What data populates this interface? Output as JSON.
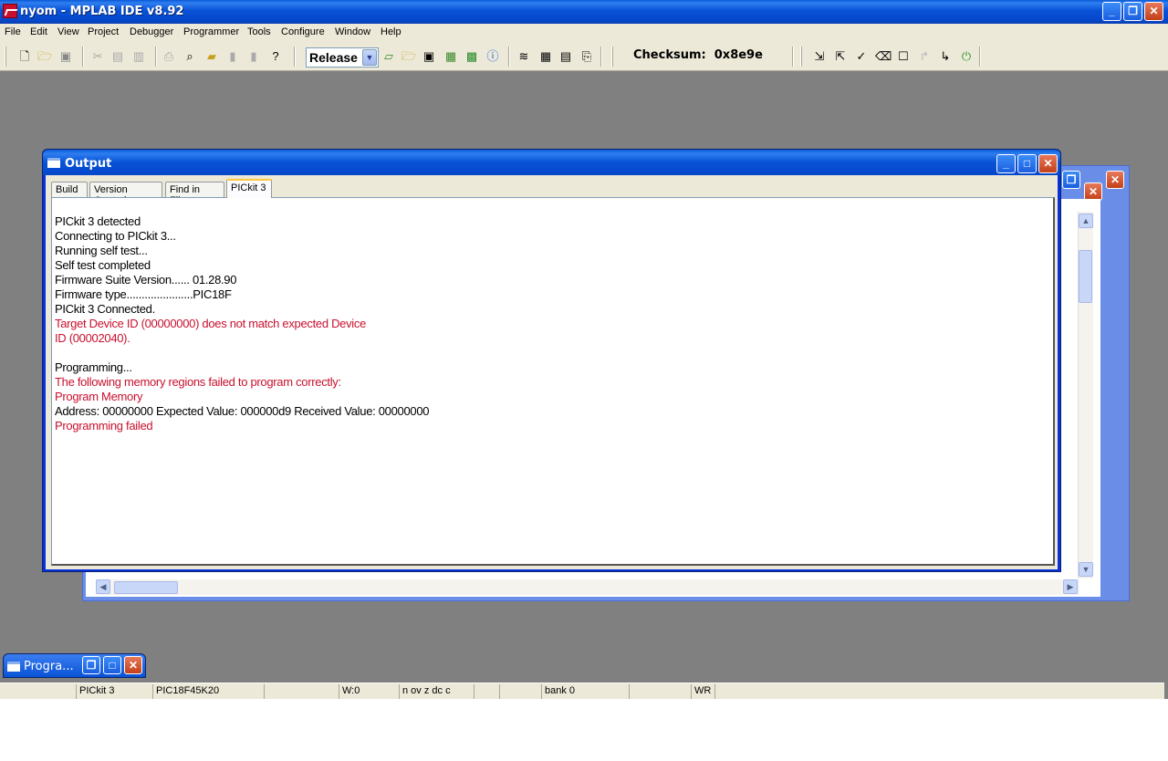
{
  "window": {
    "title": "nyom - MPLAB IDE v8.92"
  },
  "menu": [
    "File",
    "Edit",
    "View",
    "Project",
    "Debugger",
    "Programmer",
    "Tools",
    "Configure",
    "Window",
    "Help"
  ],
  "toolbar": {
    "build_config": "Release",
    "checksum_label": "Checksum:",
    "checksum_value": "0x8e9e"
  },
  "output_window": {
    "title": "Output",
    "tabs": [
      "Build",
      "Version Control",
      "Find in Files",
      "PICkit 3"
    ],
    "active_tab": "PICkit 3",
    "lines": [
      {
        "text": "PICkit 3 detected",
        "error": false
      },
      {
        "text": "Connecting to PICkit 3...",
        "error": false
      },
      {
        "text": "Running self test...",
        "error": false
      },
      {
        "text": "Self test completed",
        "error": false
      },
      {
        "text": "Firmware Suite Version...... 01.28.90",
        "error": false
      },
      {
        "text": "Firmware type......................PIC18F",
        "error": false
      },
      {
        "text": "PICkit 3 Connected.",
        "error": false
      },
      {
        "text": "Target Device ID (00000000) does not match expected Device",
        "error": true
      },
      {
        "text": "ID (00002040).",
        "error": true
      },
      {
        "text": "",
        "error": false
      },
      {
        "text": "Programming...",
        "error": false
      },
      {
        "text": "The following memory regions failed to program correctly:",
        "error": true
      },
      {
        "text": "Program Memory",
        "error": true
      },
      {
        "text": "Address: 00000000 Expected Value: 000000d9 Received Value: 00000000",
        "error": false
      },
      {
        "text": "Programming failed",
        "error": true
      }
    ]
  },
  "minimized_window": {
    "title": "Progra..."
  },
  "statusbar": {
    "programmer": "PICkit 3",
    "device": "PIC18F45K20",
    "w_reg": "W:0",
    "flags": "n ov z dc c",
    "bank": "bank 0",
    "mode": "WR"
  },
  "colors": {
    "error_text": "#c8102e",
    "titlebar": "#0852d6",
    "desktop": "#808080"
  }
}
